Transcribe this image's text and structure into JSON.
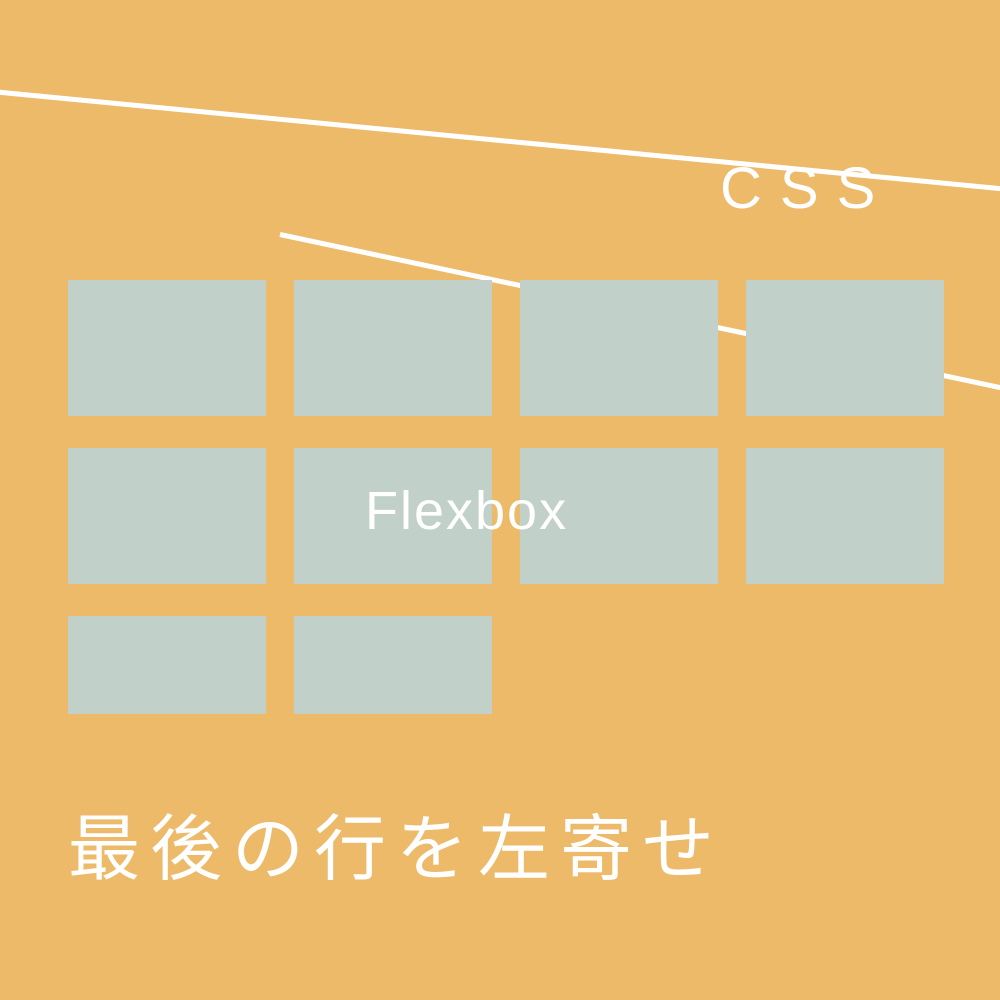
{
  "labels": {
    "css": "CSS",
    "flexbox": "Flexbox",
    "bottom": "最後の行を左寄せ"
  },
  "grid": {
    "rows": [
      {
        "count": 4,
        "short": false
      },
      {
        "count": 4,
        "short": false
      },
      {
        "count": 2,
        "short": true
      }
    ]
  },
  "colors": {
    "background": "#edba6a",
    "cell": "#c1d0c8",
    "text": "#ffffff",
    "line": "#ffffff"
  }
}
